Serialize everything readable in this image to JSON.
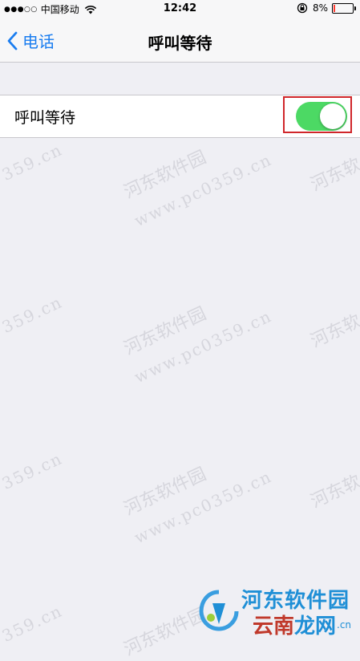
{
  "status_bar": {
    "signal": "●●●○○",
    "carrier": "中国移动",
    "time": "12:42",
    "battery_percent": "8%",
    "battery_level": 0.08,
    "icons": [
      "wifi-icon",
      "rotation-lock-icon",
      "battery-icon"
    ]
  },
  "nav": {
    "back_label": "电话",
    "title": "呼叫等待",
    "accent_color": "#1a7df0"
  },
  "setting": {
    "label": "呼叫等待",
    "toggle_on": true,
    "toggle_color": "#4cd964",
    "highlight_color": "#d0262a"
  },
  "watermark": {
    "text": "河东软件园",
    "url": "www.pc0359.cn",
    "fragment_left": "359.cn",
    "fragment_right": "河东软"
  },
  "logo": {
    "name": "河东软件园",
    "site_a": "云南",
    "site_b": "龙网",
    "site_suffix": ".cn"
  }
}
